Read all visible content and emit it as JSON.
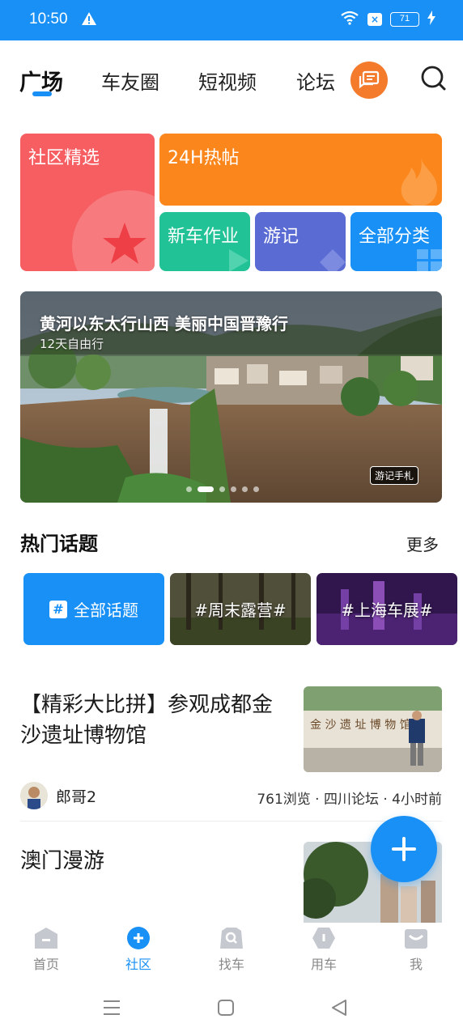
{
  "status_bar": {
    "time": "10:50",
    "battery": "71"
  },
  "top_nav": {
    "tabs": [
      "广场",
      "车友圈",
      "短视频",
      "论坛"
    ],
    "active": "广场"
  },
  "categories": {
    "featured": "社区精选",
    "hot": "24H热帖",
    "new_car": "新车作业",
    "travel": "游记",
    "all": "全部分类"
  },
  "banner": {
    "title": "黄河以东太行山西 美丽中国晋豫行",
    "subtitle": "12天自由行",
    "tag": "游记手札",
    "page_count": 6,
    "active_page": 2
  },
  "hot_topics": {
    "title": "热门话题",
    "more": "更多",
    "items": [
      "全部话题",
      "#周末露营#",
      "#上海车展#"
    ]
  },
  "feed": [
    {
      "title": "【精彩大比拼】参观成都金沙遗址博物馆",
      "author": "郎哥2",
      "meta": "761浏览 · 四川论坛 · 4小时前"
    },
    {
      "title": "澳门漫游"
    }
  ],
  "bottom_nav": {
    "items": [
      "首页",
      "社区",
      "找车",
      "用车",
      "我"
    ],
    "active": "社区"
  },
  "colors": {
    "accent": "#1890f5",
    "featured": "#f65e62",
    "hot": "#fb861c",
    "new_car": "#22c297",
    "travel": "#5a6cd3",
    "message": "#f47a2c"
  }
}
